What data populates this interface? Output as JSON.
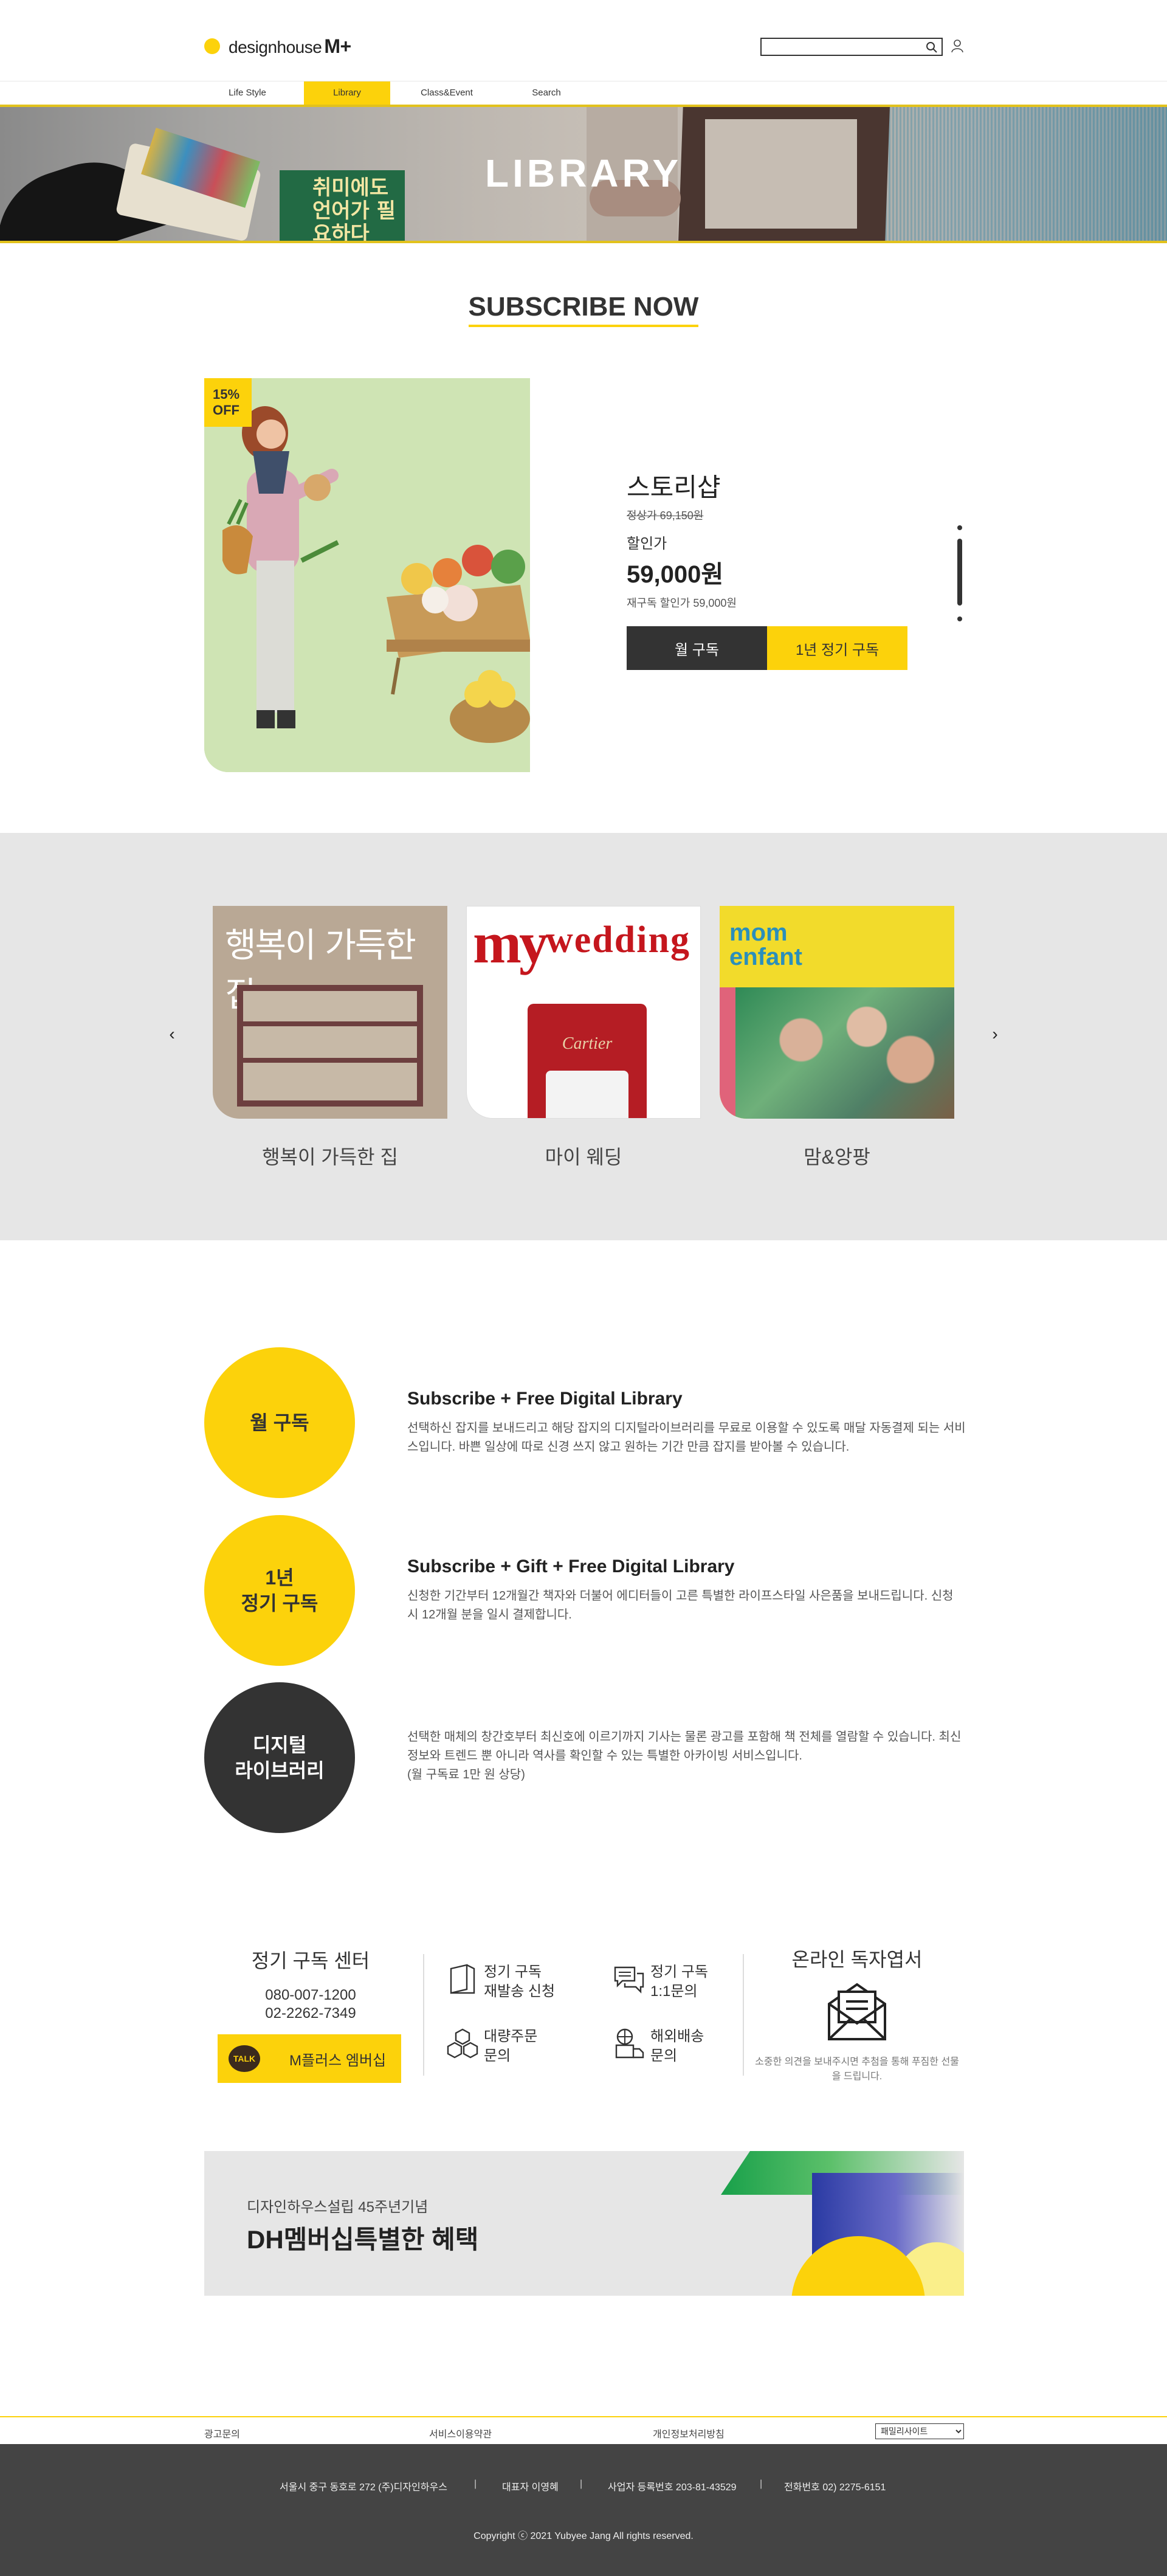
{
  "header": {
    "logo_text": "designhouse",
    "logo_bold": "M+",
    "search_placeholder": "",
    "nav": [
      "Life Style",
      "Library",
      "Class&Event",
      "Search"
    ],
    "active_nav": "Library"
  },
  "hero": {
    "title": "LIBRARY",
    "book_text": "취미에도 언어가 필요하다"
  },
  "subscribe": {
    "title": "SUBSCRIBE NOW",
    "badge": "15%\nOFF",
    "product_name": "스토리샵",
    "original_price": "정상가 69,150원",
    "sale_label": "할인가",
    "sale_price": "59,000원",
    "renew_price": "재구독 할인가 59,000원",
    "btn_month": "월 구독",
    "btn_year": "1년 정기 구독"
  },
  "carousel": {
    "prev": "‹",
    "next": "›",
    "items": [
      {
        "label": "행복이 가득한 집",
        "cover_title": "행복이 가득한 집"
      },
      {
        "label": "마이 웨딩",
        "cover_title": "my",
        "cover_sub": "wedding",
        "cover_brand": "Cartier"
      },
      {
        "label": "맘&앙팡",
        "cover_title": "mom enfant"
      }
    ]
  },
  "plans": [
    {
      "circle": "월 구독",
      "title": "Subscribe + Free Digital Library",
      "text": "선택하신 잡지를 보내드리고 해당 잡지의 디지털라이브러리를 무료로 이용할 수 있도록 매달 자동결제 되는 서비스입니다. 바쁜 일상에 따로 신경 쓰지 않고 원하는 기간 만큼 잡지를 받아볼 수 있습니다."
    },
    {
      "circle": "1년\n정기 구독",
      "title": "Subscribe + Gift + Free Digital Library",
      "text": "신청한 기간부터 12개월간 책자와 더불어 에디터들이 고른 특별한 라이프스타일 사은품을 보내드립니다. 신청 시 12개월 분을 일시 결제합니다."
    },
    {
      "circle": "디지털\n라이브러리",
      "title": "",
      "text": "선택한 매체의 창간호부터 최신호에 이르기까지 기사는 물론 광고를 포함해 책 전체를 열람할 수 있습니다. 최신 정보와 트렌드 뿐 아니라 역사를 확인할 수 있는 특별한 아카이빙 서비스입니다.\n(월 구독료 1만 원 상당)"
    }
  ],
  "contact": {
    "center_title": "정기 구독 센터",
    "phone1": "080-007-1200",
    "phone2": "02-2262-7349",
    "kakao_icon": "TALK",
    "kakao_label": "M플러스 엠버십",
    "services": [
      {
        "label": "정기 구독\n재발송 신청",
        "icon": "book-icon"
      },
      {
        "label": "정기 구독\n1:1문의",
        "icon": "chat-icon"
      },
      {
        "label": "대량주문\n문의",
        "icon": "boxes-icon"
      },
      {
        "label": "해외배송\n문의",
        "icon": "global-delivery-icon"
      }
    ],
    "reader_title": "온라인 독자엽서",
    "reader_text": "소중한 의견을 보내주시면 추첨을 통해 푸짐한 선물을 드립니다."
  },
  "banner": {
    "sub": "디자인하우스설립 45주년기념",
    "title": "DH멤버십특별한 혜택"
  },
  "footer": {
    "links": [
      "광고문의",
      "서비스이용약관",
      "개인정보처리방침"
    ],
    "family_site": "패밀리사이트",
    "info": [
      "서울시 중구 동호로 272 (주)디자인하우스",
      "대표자 이영혜",
      "사업자 등록번호 203-81-43529",
      "전화번호 02) 2275-6151"
    ],
    "separator": "|",
    "copyright": "Copyright ⓒ 2021 Yubyee Jang All rights reserved."
  },
  "colors": {
    "accent": "#fcd20b",
    "dark": "#333333",
    "footer_bg": "#444444",
    "carousel_bg": "#e6e6e6"
  }
}
